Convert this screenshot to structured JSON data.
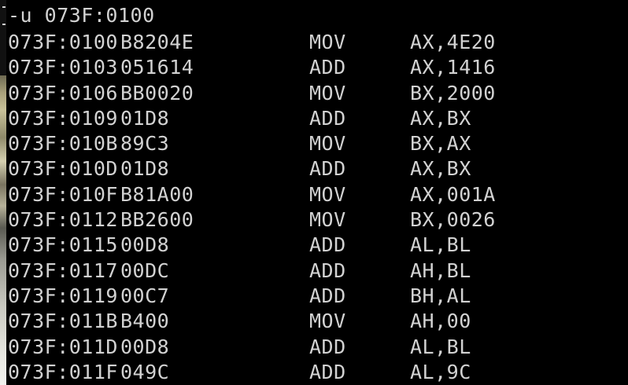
{
  "prompt_line": "-u 073F:0100",
  "disassembly": [
    {
      "address": "073F:0100",
      "bytes": "B8204E",
      "mnemonic": "MOV",
      "operands": "AX,4E20"
    },
    {
      "address": "073F:0103",
      "bytes": "051614",
      "mnemonic": "ADD",
      "operands": "AX,1416"
    },
    {
      "address": "073F:0106",
      "bytes": "BB0020",
      "mnemonic": "MOV",
      "operands": "BX,2000"
    },
    {
      "address": "073F:0109",
      "bytes": "01D8",
      "mnemonic": "ADD",
      "operands": "AX,BX"
    },
    {
      "address": "073F:010B",
      "bytes": "89C3",
      "mnemonic": "MOV",
      "operands": "BX,AX"
    },
    {
      "address": "073F:010D",
      "bytes": "01D8",
      "mnemonic": "ADD",
      "operands": "AX,BX"
    },
    {
      "address": "073F:010F",
      "bytes": "B81A00",
      "mnemonic": "MOV",
      "operands": "AX,001A"
    },
    {
      "address": "073F:0112",
      "bytes": "BB2600",
      "mnemonic": "MOV",
      "operands": "BX,0026"
    },
    {
      "address": "073F:0115",
      "bytes": "00D8",
      "mnemonic": "ADD",
      "operands": "AL,BL"
    },
    {
      "address": "073F:0117",
      "bytes": "00DC",
      "mnemonic": "ADD",
      "operands": "AH,BL"
    },
    {
      "address": "073F:0119",
      "bytes": "00C7",
      "mnemonic": "ADD",
      "operands": "BH,AL"
    },
    {
      "address": "073F:011B",
      "bytes": "B400",
      "mnemonic": "MOV",
      "operands": "AH,00"
    },
    {
      "address": "073F:011D",
      "bytes": "00D8",
      "mnemonic": "ADD",
      "operands": "AL,BL"
    },
    {
      "address": "073F:011F",
      "bytes": "049C",
      "mnemonic": "ADD",
      "operands": "AL,9C"
    }
  ],
  "colors": {
    "background": "#000000",
    "text": "#d2d2d2"
  }
}
